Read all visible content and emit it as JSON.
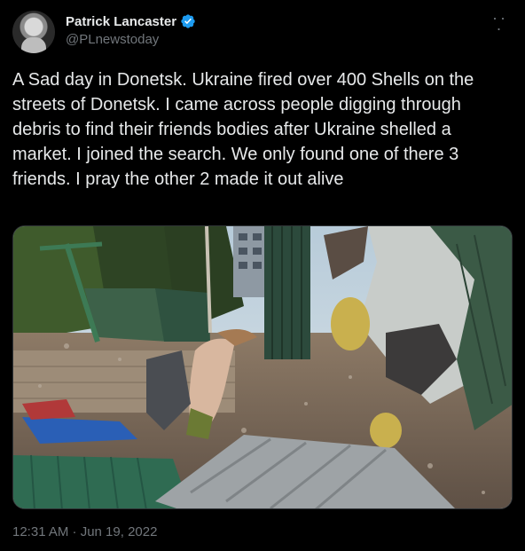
{
  "author": {
    "display_name": "Patrick Lancaster",
    "handle": "@PLnewstoday",
    "verified": true,
    "avatar_icon": "profile-photo"
  },
  "tweet": {
    "text": "A Sad day in Donetsk. Ukraine fired over 400 Shells on the streets of Donetsk. I came across people digging through debris to find their friends bodies after Ukraine shelled a market. I joined the search. We only found one of there 3 friends. I pray the other 2 made it out alive",
    "timestamp": "12:31 AM · Jun 19, 2022"
  },
  "icons": {
    "verified": "verified-badge-icon",
    "more": "more-options-icon"
  },
  "colors": {
    "background": "#000000",
    "text_primary": "#e7e9ea",
    "text_secondary": "#71767b",
    "verified_blue": "#1d9bf0",
    "border": "#2f3336"
  }
}
